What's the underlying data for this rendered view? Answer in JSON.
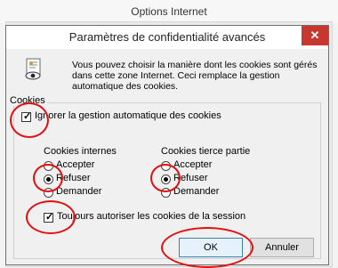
{
  "window": {
    "title": "Options Internet"
  },
  "dialog": {
    "title": "Paramètres de confidentialité avancés",
    "close_label": "✕",
    "intro": "Vous pouvez choisir la manière dont les cookies sont gérés dans cette zone Internet. Ceci remplace la gestion automatique des cookies."
  },
  "cookies": {
    "group_label": "Cookies",
    "override_label": "Ignorer la gestion automatique des cookies",
    "override_checked": true,
    "first_party": {
      "heading": "Cookies internes",
      "options": [
        "Accepter",
        "Refuser",
        "Demander"
      ],
      "selected": "Refuser"
    },
    "third_party": {
      "heading": "Cookies tierce partie",
      "options": [
        "Accepter",
        "Refuser",
        "Demander"
      ],
      "selected": "Refuser"
    },
    "session_label": "Toujours autoriser les cookies de la session",
    "session_checked": true
  },
  "buttons": {
    "ok": "OK",
    "cancel": "Annuler"
  },
  "icons": {
    "privacy": "privacy-document-eye-icon",
    "close": "close-icon"
  },
  "colors": {
    "annotation": "#e01010",
    "close_button": "#c7372f",
    "ok_border": "#3c7fb1"
  }
}
